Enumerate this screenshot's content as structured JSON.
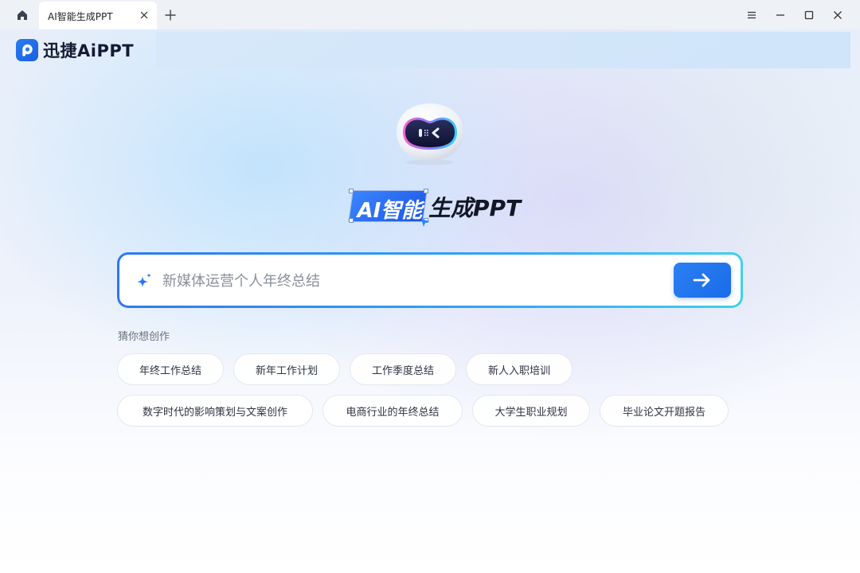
{
  "tabbar": {
    "tab_title": "AI智能生成PPT"
  },
  "brand": {
    "name": "迅捷AiPPT",
    "color": "#1b5fe0"
  },
  "hero": {
    "badge": "AI智能",
    "rest": "生成PPT"
  },
  "search": {
    "placeholder": "新媒体运营个人年终总结",
    "value": ""
  },
  "suggestions": {
    "title": "猜你想创作",
    "row1": [
      "年终工作总结",
      "新年工作计划",
      "工作季度总结",
      "新人入职培训"
    ],
    "row2": [
      "数字时代的影响策划与文案创作",
      "电商行业的年终总结",
      "大学生职业规划",
      "毕业论文开题报告"
    ]
  },
  "icons": {
    "home": "home-icon",
    "close": "close-icon",
    "plus": "plus-icon",
    "menu": "menu-icon",
    "minimize": "minimize-icon",
    "maximize": "maximize-icon",
    "sparkle": "sparkle-icon",
    "send": "arrow-right-icon",
    "robot": "robot-mascot"
  },
  "colors": {
    "accent": "#2b7ff3",
    "accent_cyan": "#3fd0f2"
  }
}
